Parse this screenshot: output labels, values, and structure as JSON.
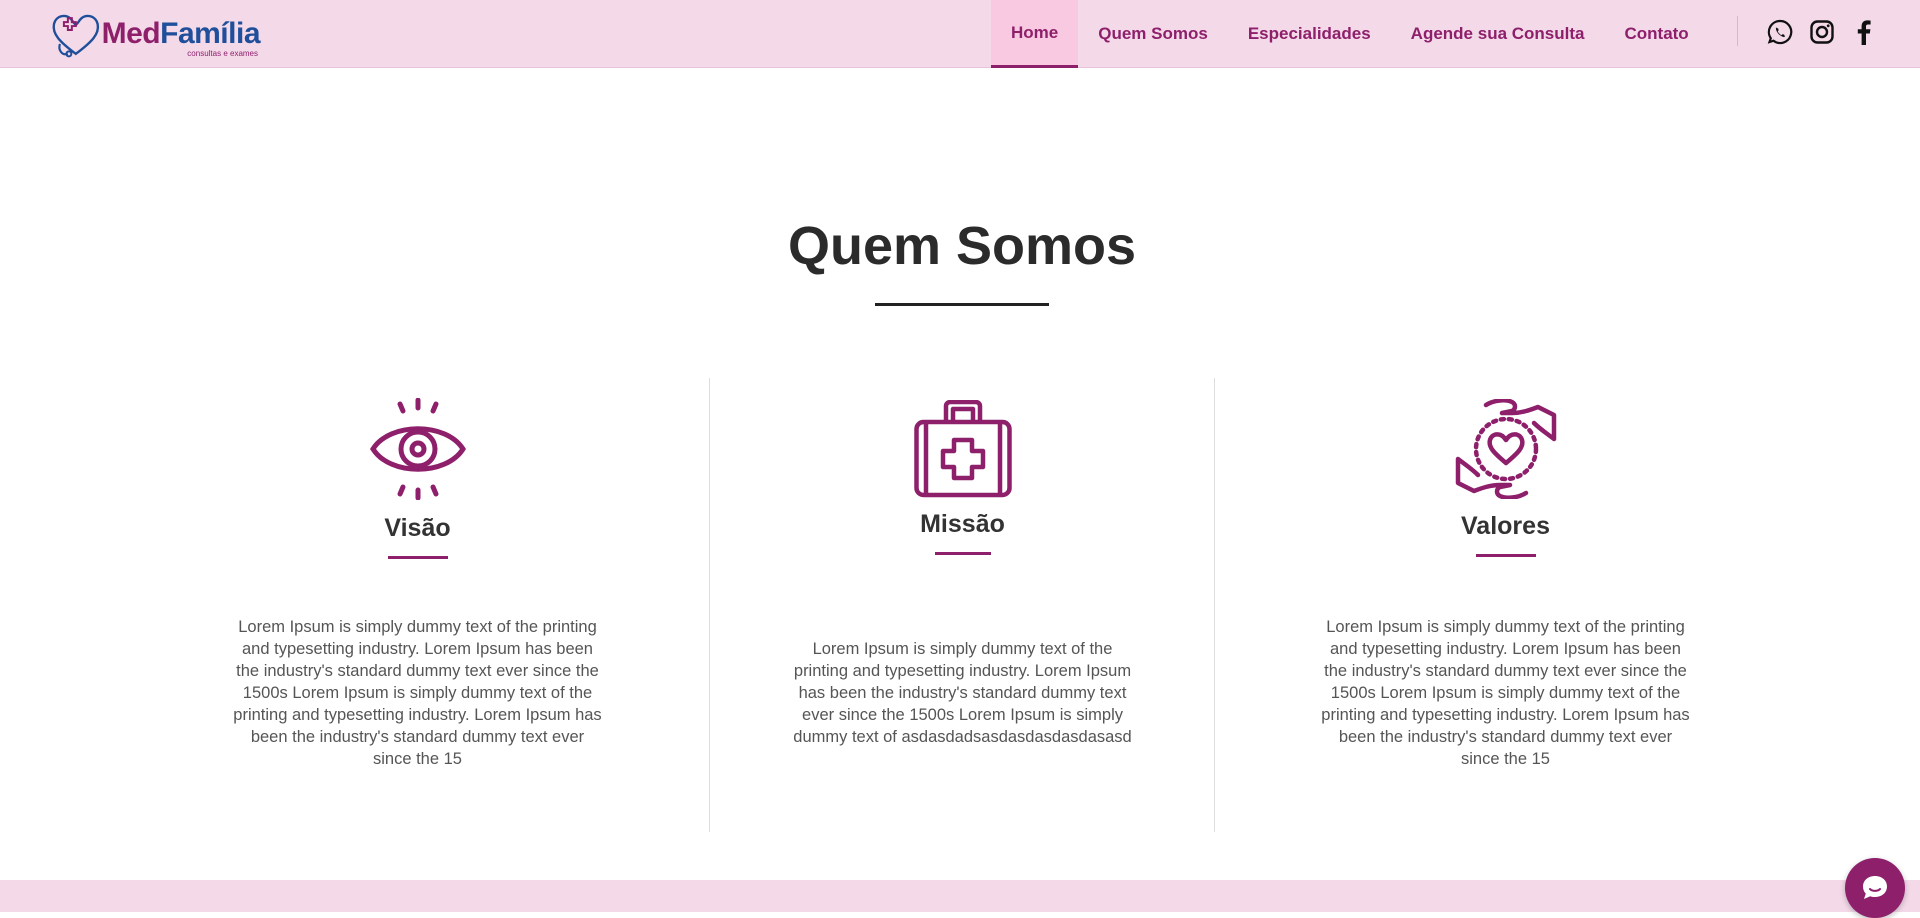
{
  "brand": {
    "name_part1": "Med",
    "name_part2": "Família",
    "tagline": "consultas e exames",
    "colors": {
      "primary": "#8e1f6b",
      "secondary": "#1f4f9b",
      "header_bg": "#f4d9e9"
    }
  },
  "nav": {
    "items": [
      {
        "label": "Home",
        "active": true
      },
      {
        "label": "Quem Somos",
        "active": false
      },
      {
        "label": "Especialidades",
        "active": false
      },
      {
        "label": "Agende sua Consulta",
        "active": false
      },
      {
        "label": "Contato",
        "active": false
      }
    ],
    "social_icons": [
      "whatsapp-icon",
      "instagram-icon",
      "facebook-icon"
    ]
  },
  "section": {
    "title": "Quem Somos",
    "columns": [
      {
        "icon": "eye-icon",
        "title": "Visão",
        "text": "Lorem Ipsum is simply dummy text of the printing and typesetting industry. Lorem Ipsum has been the industry's standard dummy text ever since the 1500s Lorem Ipsum is simply dummy text of the printing and typesetting industry. Lorem Ipsum has been the industry's standard dummy text ever since the 15"
      },
      {
        "icon": "medical-kit-icon",
        "title": "Missão",
        "text": "Lorem Ipsum is simply dummy text of the printing and typesetting industry. Lorem Ipsum has been the industry's standard dummy text ever since the 1500s Lorem Ipsum is simply dummy text of asdasdadsasdasdasdasdasasd"
      },
      {
        "icon": "hands-heart-icon",
        "title": "Valores",
        "text": "Lorem Ipsum is simply dummy text of the printing and typesetting industry. Lorem Ipsum has been the industry's standard dummy text ever since the 1500s Lorem Ipsum is simply dummy text of the printing and typesetting industry. Lorem Ipsum has been the industry's standard dummy text ever since the 15"
      }
    ]
  },
  "chat": {
    "icon": "chat-bubble-icon"
  }
}
